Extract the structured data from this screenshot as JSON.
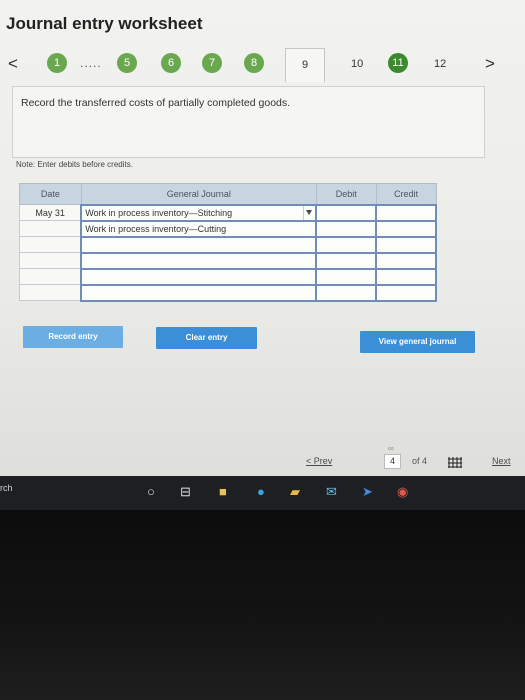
{
  "title": "Journal entry worksheet",
  "stepper": {
    "prev_arrow": "<",
    "next_arrow": ">",
    "dots": ".....",
    "steps": [
      "1",
      "5",
      "6",
      "7",
      "8",
      "9",
      "10",
      "11",
      "12"
    ]
  },
  "instruction": "Record the transferred costs of partially completed goods.",
  "note": "Note: Enter debits before credits.",
  "journal": {
    "headers": [
      "Date",
      "General Journal",
      "Debit",
      "Credit"
    ],
    "rows": [
      {
        "date": "May 31",
        "account": "Work in process inventory—Stitching",
        "debit": "",
        "credit": ""
      },
      {
        "date": "",
        "account": "Work in process inventory—Cutting",
        "debit": "",
        "credit": ""
      },
      {
        "date": "",
        "account": "",
        "debit": "",
        "credit": ""
      },
      {
        "date": "",
        "account": "",
        "debit": "",
        "credit": ""
      },
      {
        "date": "",
        "account": "",
        "debit": "",
        "credit": ""
      },
      {
        "date": "",
        "account": "",
        "debit": "",
        "credit": ""
      }
    ]
  },
  "buttons": {
    "record": "Record entry",
    "clear": "Clear entry",
    "view": "View general journal"
  },
  "pager": {
    "prev": "< Prev",
    "current": "4",
    "of": "of 4",
    "next": "Next"
  },
  "taskbar": {
    "search": "rch"
  },
  "colors": {
    "accent": "#3b8fd6",
    "step_green": "#6aa84f",
    "header_bg": "#c9d4e1"
  }
}
